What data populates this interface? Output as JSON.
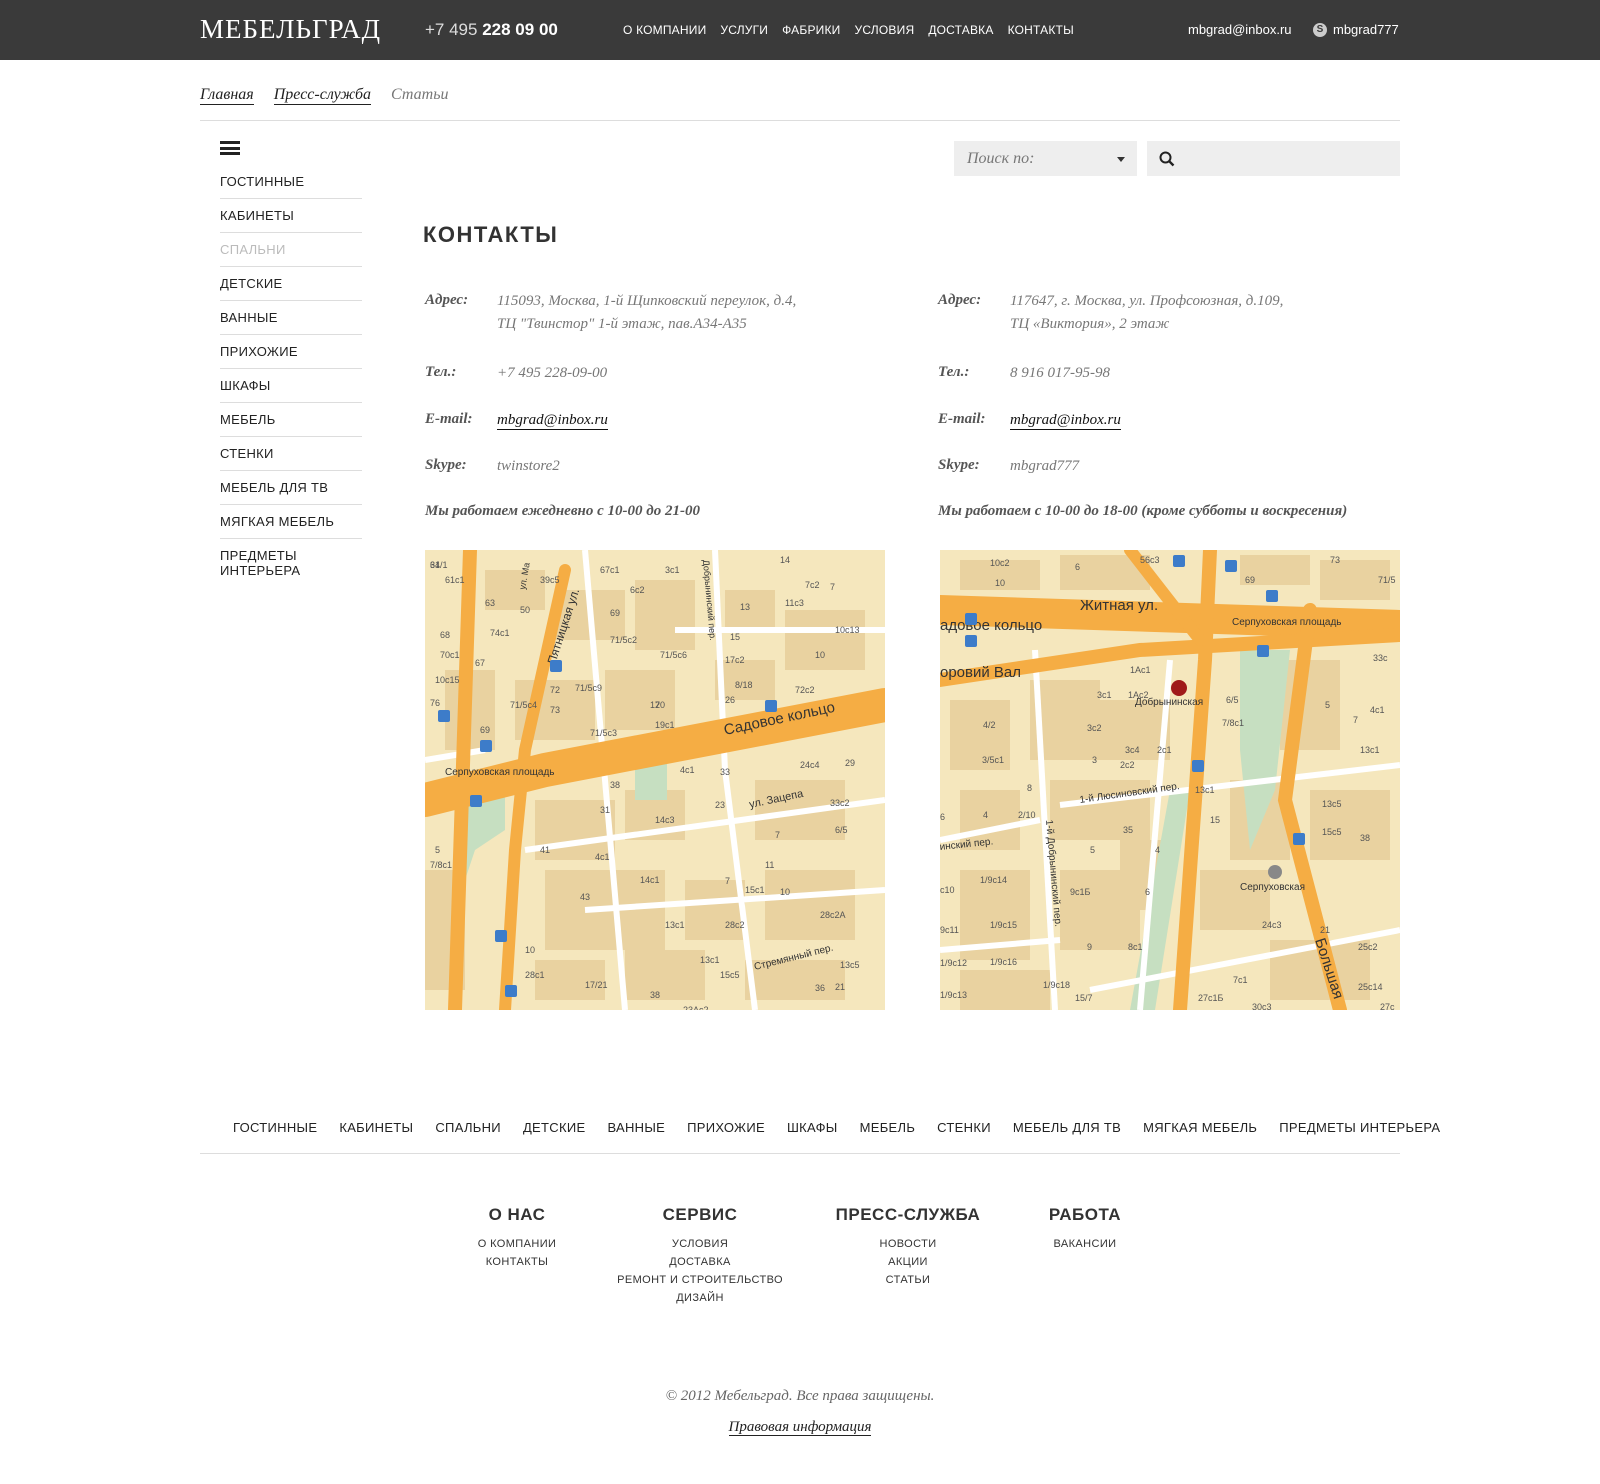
{
  "header": {
    "logo": "МЕБЕЛЬГРАД",
    "phone_prefix": "+7 495",
    "phone_main": "228 09 00",
    "nav": [
      "О КОМПАНИИ",
      "УСЛУГИ",
      "ФАБРИКИ",
      "УСЛОВИЯ",
      "ДОСТАВКА",
      "КОНТАКТЫ"
    ],
    "email": "mbgrad@inbox.ru",
    "skype": "mbgrad777"
  },
  "breadcrumb": {
    "home": "Главная",
    "press": "Пресс-служба",
    "current": "Статьи"
  },
  "sidebar": {
    "items": [
      "ГОСТИННЫЕ",
      "КАБИНЕТЫ",
      "СПАЛЬНИ",
      "ДЕТСКИЕ",
      "ВАННЫЕ",
      "ПРИХОЖИЕ",
      "ШКАФЫ",
      "МЕБЕЛЬ",
      "СТЕНКИ",
      "МЕБЕЛЬ ДЛЯ ТВ",
      "МЯГКАЯ МЕБЕЛЬ",
      "ПРЕДМЕТЫ ИНТЕРЬЕРА"
    ]
  },
  "search": {
    "select_placeholder": "Поиск по:"
  },
  "page_title": "КОНТАКТЫ",
  "contacts": [
    {
      "address_label": "Адрес:",
      "address_line1": "115093, Москва, 1-й Щипковский переулок, д.4,",
      "address_line2": "ТЦ \"Твинстор\" 1-й этаж, пав.А34-А35",
      "phone_label": "Тел.:",
      "phone": "+7 495 228-09-00",
      "email_label": "E-mail:",
      "email": "mbgrad@inbox.ru",
      "skype_label": "Skype:",
      "skype": "twinstore2",
      "hours": "Мы работаем ежедневно с 10-00 до 21-00",
      "map": {
        "labels": [
          "Садовое кольцо",
          "Пятницкая ул.",
          "ул. Зацепа",
          "Стремянный пер.",
          "Серпуховская площадь",
          "Добрынинский пер.",
          "ул. Ма"
        ],
        "numbers": [
          "64",
          "61с1",
          "39с5",
          "67с1",
          "3с1",
          "14",
          "7с2",
          "7",
          "63",
          "50",
          "6с2",
          "13",
          "11с3",
          "68",
          "74с1",
          "69",
          "15",
          "10с13",
          "70с1",
          "67",
          "71/5с2",
          "71/5с6",
          "17с2",
          "10",
          "10с15",
          "72",
          "71/5с9",
          "17",
          "8/18",
          "72с2",
          "76",
          "71/5с4",
          "26",
          "20",
          "73",
          "69",
          "71/5с3",
          "19с1",
          "24с4",
          "29",
          "4с1",
          "33",
          "38",
          "23",
          "33с2",
          "31",
          "14с3",
          "6/5",
          "5",
          "41",
          "7",
          "7/8с1",
          "4с1",
          "11",
          "14с1",
          "7",
          "43",
          "10",
          "13с1",
          "28с2",
          "28с2А",
          "15с1",
          "10",
          "13с1",
          "13с5",
          "28с1",
          "17/21",
          "15с5",
          "38",
          "36",
          "28",
          "21",
          "23Ас2",
          "31/1"
        ]
      }
    },
    {
      "address_label": "Адрес:",
      "address_line1": "117647, г. Москва, ул. Профсоюзная, д.109,",
      "address_line2": "ТЦ «Виктория», 2 этаж",
      "phone_label": "Тел.:",
      "phone": "8 916 017-95-98",
      "email_label": "E-mail:",
      "email": "mbgrad@inbox.ru",
      "skype_label": "Skype:",
      "skype": "mbgrad777",
      "hours": "Мы работаем с 10-00 до 18-00 (кроме субботы и воскресения)",
      "map": {
        "labels": [
          "Житная ул.",
          "адовое кольцо",
          "Серпуховская площадь",
          "оровий Вал",
          "Добрынинская",
          "1-й Люсиновский пер.",
          "1-й Добрынинский пер.",
          "инский пер.",
          "Серпуховская",
          "Большая"
        ],
        "numbers": [
          "10с2",
          "6",
          "56с3",
          "73",
          "10",
          "69",
          "71/5",
          "1Ас1",
          "33с",
          "3с1",
          "1Ас2",
          "6/5",
          "5",
          "4с1",
          "4/2",
          "3с2",
          "7/8с1",
          "7",
          "13с1",
          "3/5с1",
          "3с4",
          "2с1",
          "3",
          "2с2",
          "13с1",
          "8",
          "4",
          "2/10",
          "15",
          "13с5",
          "6",
          "35",
          "15с5",
          "5",
          "4",
          "38",
          "1/9с14",
          "9с1Б",
          "6",
          "с10",
          "1/9с15",
          "24с3",
          "9с11",
          "9",
          "8с1",
          "21",
          "25с2",
          "1/9с12",
          "1/9с16",
          "1/9с18",
          "25с14",
          "15/7",
          "7с1",
          "1/9с13",
          "27с1Б",
          "30с3",
          "27с"
        ]
      }
    }
  ],
  "footer": {
    "categories": [
      "ГОСТИННЫЕ",
      "КАБИНЕТЫ",
      "СПАЛЬНИ",
      "ДЕТСКИЕ",
      "ВАННЫЕ",
      "ПРИХОЖИЕ",
      "ШКАФЫ",
      "МЕБЕЛЬ",
      "СТЕНКИ",
      "МЕБЕЛЬ ДЛЯ ТВ",
      "МЯГКАЯ МЕБЕЛЬ",
      "ПРЕДМЕТЫ ИНТЕРЬЕРА"
    ],
    "columns": [
      {
        "title": "О НАС",
        "links": [
          "О КОМПАНИИ",
          "КОНТАКТЫ"
        ]
      },
      {
        "title": "СЕРВИС",
        "links": [
          "УСЛОВИЯ",
          "ДОСТАВКА",
          "РЕМОНТ И СТРОИТЕЛЬСТВО",
          "ДИЗАЙН"
        ]
      },
      {
        "title": "ПРЕСС-СЛУЖБА",
        "links": [
          "НОВОСТИ",
          "АКЦИИ",
          "СТАТЬИ"
        ]
      },
      {
        "title": "РАБОТА",
        "links": [
          "ВАКАНСИИ"
        ]
      }
    ],
    "copyright": "© 2012  Мебельград. Все права защищены.",
    "legal": "Правовая информация"
  },
  "colors": {
    "topbar": "#3a3a3a",
    "map_bg": "#f5e7bd",
    "map_road": "#f5ad44",
    "map_block": "#e9d2a0",
    "map_park": "#c6dfc1",
    "bus_stop": "#3d7cc9"
  }
}
